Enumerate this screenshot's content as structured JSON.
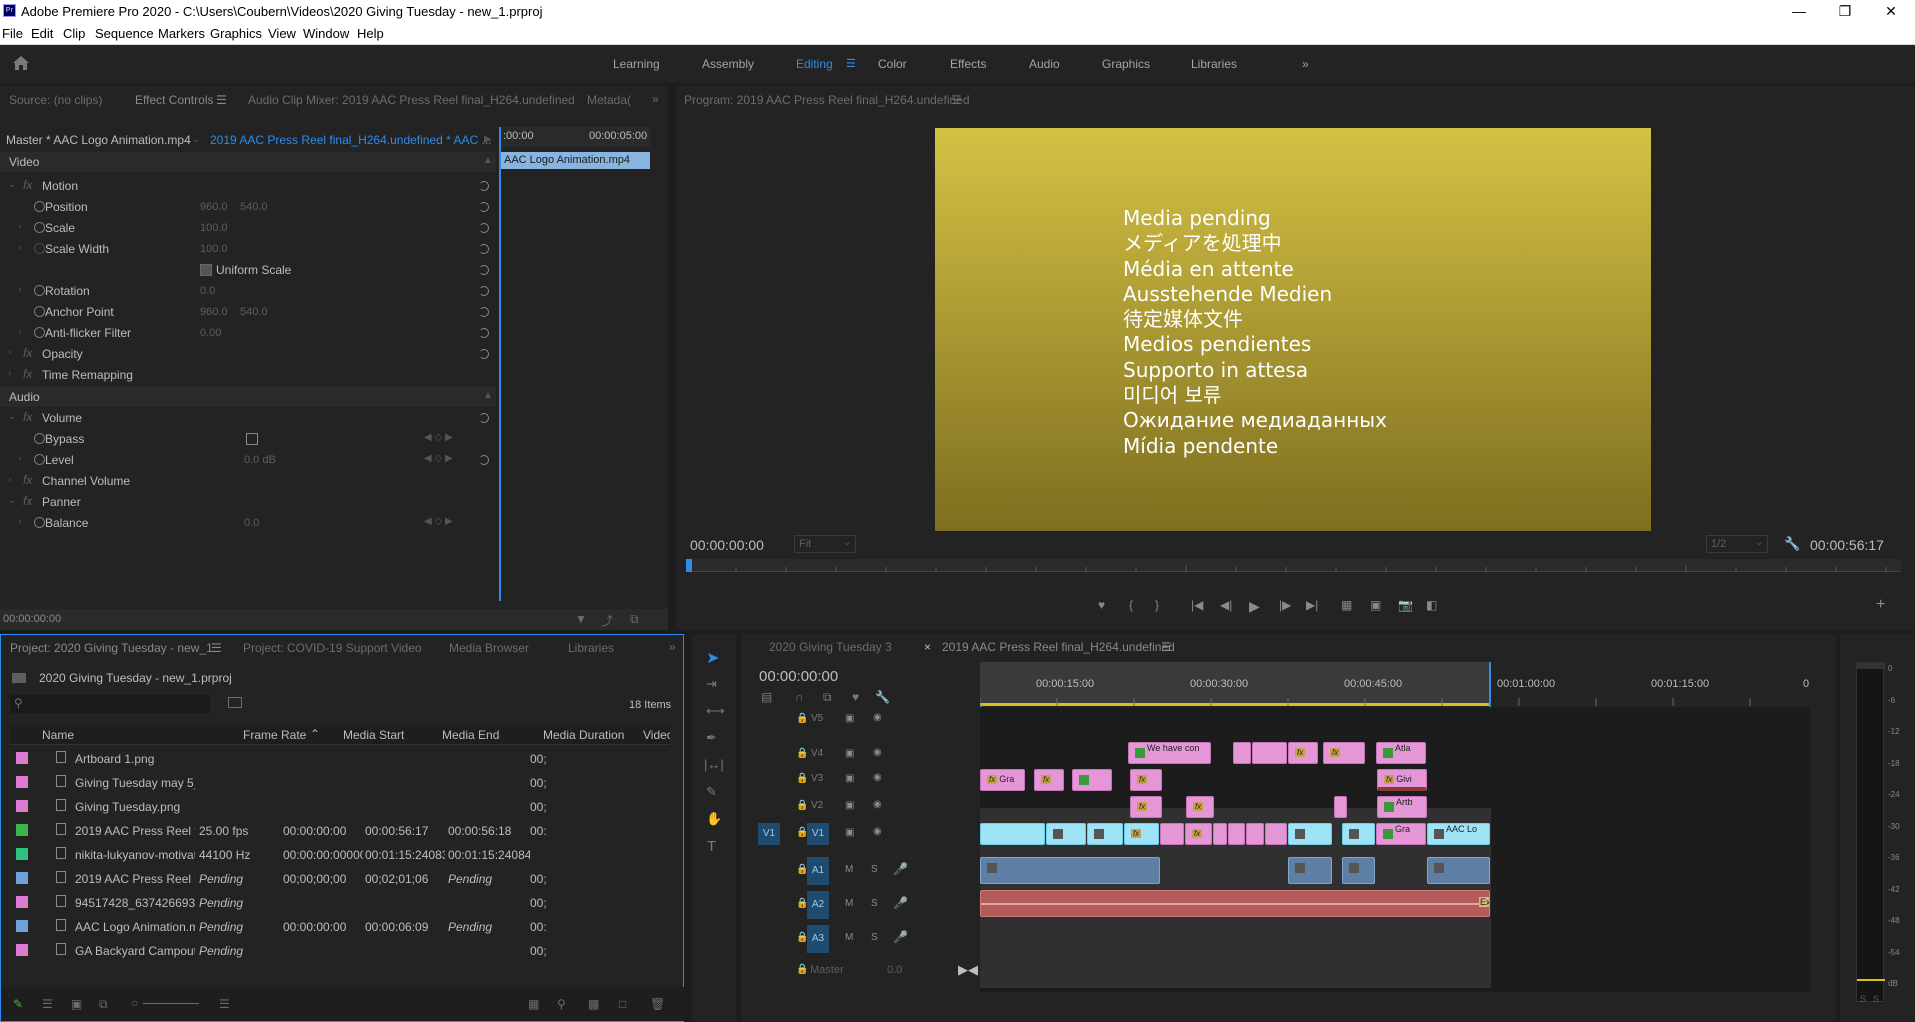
{
  "window": {
    "title": "Adobe Premiere Pro 2020 - C:\\Users\\Coubern\\Videos\\2020 Giving Tuesday - new_1.prproj",
    "app_logo": "Pr"
  },
  "menu": [
    "File",
    "Edit",
    "Clip",
    "Sequence",
    "Markers",
    "Graphics",
    "View",
    "Window",
    "Help"
  ],
  "workspaces": [
    {
      "label": "Learning",
      "active": false
    },
    {
      "label": "Assembly",
      "active": false
    },
    {
      "label": "Editing",
      "active": true
    },
    {
      "label": "Color",
      "active": false
    },
    {
      "label": "Effects",
      "active": false
    },
    {
      "label": "Audio",
      "active": false
    },
    {
      "label": "Graphics",
      "active": false
    },
    {
      "label": "Libraries",
      "active": false
    }
  ],
  "source_panel": {
    "tabs": [
      "Source: (no clips)",
      "Effect Controls",
      "Audio Clip Mixer: 2019 AAC Press Reel final_H264.undefined",
      "Metada("
    ],
    "master_clip": "Master * AAC Logo Animation.mp4",
    "sequence_clip": "2019 AAC Press Reel final_H264.undefined * AAC ...",
    "mini_ruler_start": ":00:00",
    "mini_ruler_end": "00:00:05:00",
    "mini_clip": "AAC Logo Animation.mp4",
    "timecode": "00:00:00:00",
    "video_header": "Video",
    "audio_header": "Audio",
    "rows": {
      "motion": "Motion",
      "position": "Position",
      "position_x": "960.0",
      "position_y": "540.0",
      "scale": "Scale",
      "scale_val": "100.0",
      "scale_width": "Scale Width",
      "scale_width_val": "100.0",
      "uniform_scale": "Uniform Scale",
      "rotation": "Rotation",
      "rotation_val": "0.0",
      "anchor": "Anchor Point",
      "anchor_x": "960.0",
      "anchor_y": "540.0",
      "antiflicker": "Anti-flicker Filter",
      "antiflicker_val": "0.00",
      "opacity": "Opacity",
      "time_remap": "Time Remapping",
      "volume": "Volume",
      "bypass": "Bypass",
      "level": "Level",
      "level_val": "0.0 dB",
      "channel_volume": "Channel Volume",
      "panner": "Panner",
      "balance": "Balance",
      "balance_val": "0.0"
    }
  },
  "program_panel": {
    "title": "Program: 2019 AAC Press Reel final_H264.undefined",
    "timecode_left": "00:00:00:00",
    "fit": "Fit",
    "quality": "1/2",
    "timecode_right": "00:00:56:17",
    "media_pending_lines": [
      "Media pending",
      "メディアを処理中",
      "Média en attente",
      "Ausstehende Medien",
      "待定媒体文件",
      "Medios pendientes",
      "Supporto in attesa",
      "미디어 보류",
      "Ожидание медиаданных",
      "Mídia pendente"
    ],
    "frame_colors": {
      "top": "#d4c245",
      "bottom": "#7e6e1f"
    }
  },
  "project_panel": {
    "tabs": [
      "Project: 2020 Giving Tuesday - new_1",
      "Project: COVID-19 Support Video",
      "Media Browser",
      "Libraries"
    ],
    "project_file": "2020 Giving Tuesday - new_1.prproj",
    "item_count": "18 Items",
    "columns": [
      "Name",
      "Frame Rate",
      "Media Start",
      "Media End",
      "Media Duration",
      "Video"
    ],
    "items": [
      {
        "color": "#e07ad0",
        "name": "Artboard 1.png",
        "fps": "",
        "start": "",
        "end": "",
        "dur": "",
        "video": "00;",
        "pending": false
      },
      {
        "color": "#e07ad0",
        "name": "Giving Tuesday may 5_grap",
        "fps": "",
        "start": "",
        "end": "",
        "dur": "",
        "video": "00;",
        "pending": false
      },
      {
        "color": "#e07ad0",
        "name": "Giving Tuesday.png",
        "fps": "",
        "start": "",
        "end": "",
        "dur": "",
        "video": "00;",
        "pending": false
      },
      {
        "color": "#3cb44b",
        "name": "2019 AAC Press Reel final_",
        "fps": "25.00 fps",
        "start": "00:00:00:00",
        "end": "00:00:56:17",
        "dur": "00:00:56:18",
        "video": "00:",
        "pending": false
      },
      {
        "color": "#2ec27e",
        "name": "nikita-lukyanov-motivation",
        "fps": "44100 Hz",
        "start": "00:00:00:00000",
        "end": "00:01:15:24083",
        "dur": "00:01:15:24084",
        "video": "",
        "pending": false
      },
      {
        "color": "#6fa0d8",
        "name": "2019 AAC Press Reel final_",
        "fps": "Pending",
        "start": "00;00;00;00",
        "end": "00;02;01;06",
        "dur": "Pending",
        "video": "00;",
        "pending": true
      },
      {
        "color": "#e07ad0",
        "name": "94517428_6374266937653",
        "fps": "Pending",
        "start": "",
        "end": "",
        "dur": "",
        "video": "00;",
        "pending": true
      },
      {
        "color": "#6fa0d8",
        "name": "AAC Logo Animation.mp4",
        "fps": "Pending",
        "start": "00:00:00:00",
        "end": "00:00:06:09",
        "dur": "Pending",
        "video": "00:",
        "pending": true
      },
      {
        "color": "#e07ad0",
        "name": "GA Backyard Campout 2_P",
        "fps": "Pending",
        "start": "",
        "end": "",
        "dur": "",
        "video": "00;",
        "pending": true
      }
    ]
  },
  "timeline": {
    "tabs": [
      "2020 Giving Tuesday 3",
      "2019 AAC Press Reel final_H264.undefined"
    ],
    "timecode": "00:00:00:00",
    "ruler_labels": [
      "00:00:15:00",
      "00:00:30:00",
      "00:00:45:00",
      "00:01:00:00",
      "00:01:15:00",
      "0"
    ],
    "tracks_video": [
      "V5",
      "V4",
      "V3",
      "V2",
      "V1"
    ],
    "tracks_audio": [
      "A1",
      "A2",
      "A3"
    ],
    "master_label": "Master",
    "master_val": "0.0",
    "clip_labels": {
      "v4_a": "We have con",
      "v4_b": "Atla",
      "v3_a": "Gra",
      "v3_b": "Givi",
      "v2_a": "Artb",
      "v1_a": "Gra",
      "v1_b": "AAC Lo",
      "a2_end": "Ex"
    }
  },
  "meter": {
    "scale": [
      "0",
      "-6",
      "-12",
      "-18",
      "-24",
      "-30",
      "-36",
      "-42",
      "-48",
      "-54",
      "dB"
    ],
    "solo": [
      "S",
      "S"
    ]
  }
}
